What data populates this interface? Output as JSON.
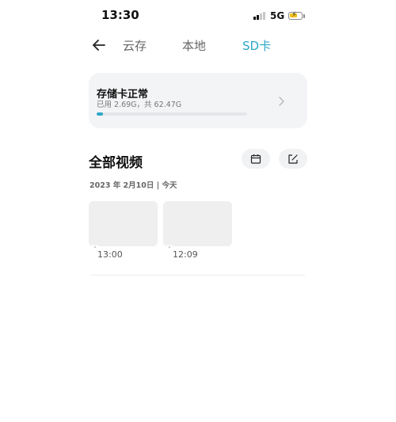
{
  "status_bar": {
    "time": "13:30",
    "network": "5G",
    "icons": [
      "signal-icon",
      "battery-charging-icon"
    ]
  },
  "nav": {
    "back_icon": "back-arrow-icon",
    "tabs": [
      {
        "label": "云存",
        "active": false
      },
      {
        "label": "本地",
        "active": false
      },
      {
        "label": "SD卡",
        "active": true
      }
    ],
    "accent_color": "#2ea7c8"
  },
  "storage": {
    "title": "存储卡正常",
    "usage_text": "已用 2.69G，共 62.47G",
    "used_fraction": 0.043,
    "chevron_icon": "chevron-right-icon"
  },
  "videos": {
    "title": "全部视频",
    "calendar_icon": "calendar-icon",
    "edit_icon": "edit-icon",
    "groups": [
      {
        "date_label": "2023 年 2月10日 | 今天",
        "items": [
          {
            "time": "13:00",
            "icon": "camera-icon"
          },
          {
            "time": "12:09",
            "icon": "camera-icon"
          }
        ]
      }
    ]
  }
}
